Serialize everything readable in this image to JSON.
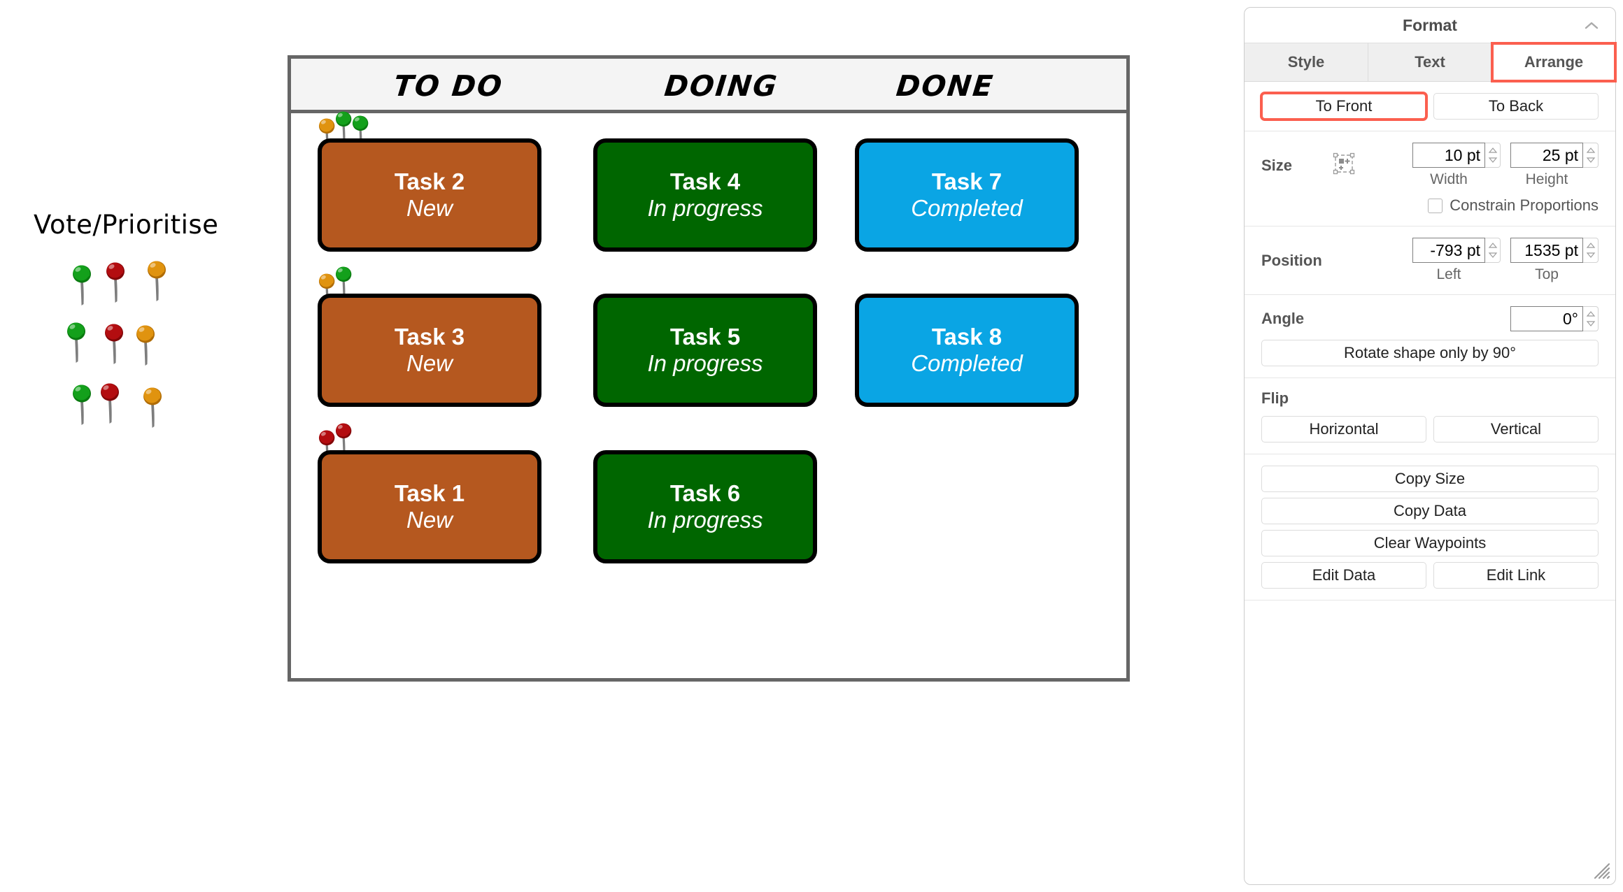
{
  "canvas": {
    "vote_label": "Vote/Prioritise",
    "pin_palette": [
      {
        "color": "green",
        "hex": "#13a01b"
      },
      {
        "color": "red",
        "hex": "#b30d10"
      },
      {
        "color": "orange",
        "hex": "#e0930f"
      },
      {
        "color": "green",
        "hex": "#13a01b"
      },
      {
        "color": "red",
        "hex": "#b30d10"
      },
      {
        "color": "orange",
        "hex": "#e0930f"
      },
      {
        "color": "green",
        "hex": "#13a01b"
      },
      {
        "color": "red",
        "hex": "#b30d10"
      },
      {
        "color": "orange",
        "hex": "#e0930f"
      }
    ]
  },
  "board": {
    "columns": [
      {
        "id": "todo",
        "header": "TO DO"
      },
      {
        "id": "doing",
        "header": "DOING"
      },
      {
        "id": "done",
        "header": "DONE"
      }
    ],
    "cards": [
      {
        "title": "Task 2",
        "status": "New",
        "column": "todo",
        "fill": "#b5581f",
        "pins": [
          "orange",
          "green",
          "green"
        ]
      },
      {
        "title": "Task 3",
        "status": "New",
        "column": "todo",
        "fill": "#b5581f",
        "pins": [
          "orange",
          "green"
        ]
      },
      {
        "title": "Task 1",
        "status": "New",
        "column": "todo",
        "fill": "#b5581f",
        "pins": [
          "red",
          "red"
        ]
      },
      {
        "title": "Task 4",
        "status": "In progress",
        "column": "doing",
        "fill": "#006600",
        "pins": []
      },
      {
        "title": "Task 5",
        "status": "In progress",
        "column": "doing",
        "fill": "#006600",
        "pins": []
      },
      {
        "title": "Task 6",
        "status": "In progress",
        "column": "doing",
        "fill": "#006600",
        "pins": []
      },
      {
        "title": "Task 7",
        "status": "Completed",
        "column": "done",
        "fill": "#0aa5e4",
        "pins": []
      },
      {
        "title": "Task 8",
        "status": "Completed",
        "column": "done",
        "fill": "#0aa5e4",
        "pins": []
      }
    ]
  },
  "format_panel": {
    "title": "Format",
    "collapse_icon": "chevron-up-icon",
    "tabs": [
      {
        "label": "Style",
        "active": false,
        "highlighted": false
      },
      {
        "label": "Text",
        "active": false,
        "highlighted": false
      },
      {
        "label": "Arrange",
        "active": true,
        "highlighted": true
      }
    ],
    "order": {
      "to_front": "To Front",
      "to_back": "To Back",
      "to_front_highlighted": true
    },
    "size": {
      "label": "Size",
      "autosize_icon": "autosize-icon",
      "width_value": "10 pt",
      "height_value": "25 pt",
      "width_label": "Width",
      "height_label": "Height",
      "constrain_label": "Constrain Proportions",
      "constrain_checked": false
    },
    "position": {
      "label": "Position",
      "left_value": "-793 pt",
      "top_value": "1535 pt",
      "left_label": "Left",
      "top_label": "Top"
    },
    "angle": {
      "label": "Angle",
      "value": "0°",
      "rotate_button": "Rotate shape only by 90°"
    },
    "flip": {
      "label": "Flip",
      "horizontal": "Horizontal",
      "vertical": "Vertical"
    },
    "actions": {
      "copy_size": "Copy Size",
      "copy_data": "Copy Data",
      "clear_waypoints": "Clear Waypoints",
      "edit_data": "Edit Data",
      "edit_link": "Edit Link"
    },
    "resize_grip_icon": "resize-grip-icon",
    "accent_color": "#fb5f4f"
  }
}
